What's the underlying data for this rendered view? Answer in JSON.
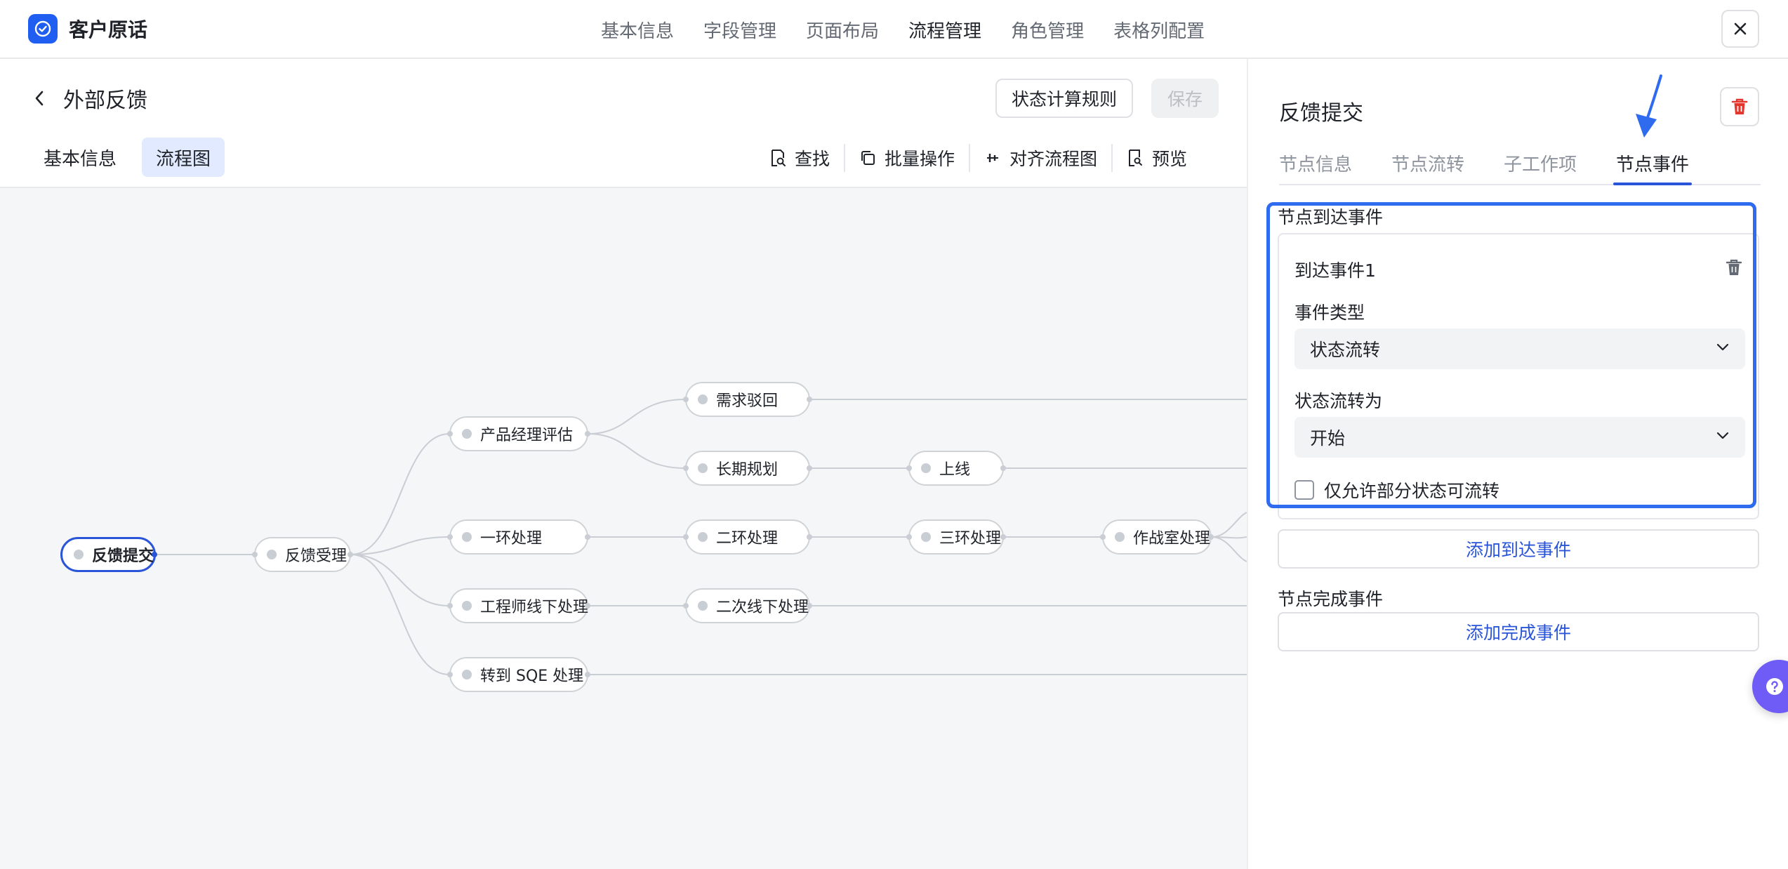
{
  "app": {
    "title": "客户原话",
    "logo_icon": "check-circle-icon",
    "brand_color": "#1f5ef0"
  },
  "topnav": {
    "items": [
      {
        "label": "基本信息"
      },
      {
        "label": "字段管理"
      },
      {
        "label": "页面布局"
      },
      {
        "label": "流程管理"
      },
      {
        "label": "角色管理"
      },
      {
        "label": "表格列配置"
      }
    ],
    "active": "流程管理"
  },
  "header": {
    "title": "外部反馈",
    "rule_button": "状态计算规则",
    "save_button": "保存"
  },
  "subtabs": [
    {
      "label": "基本信息"
    },
    {
      "label": "流程图"
    }
  ],
  "subtab_active": "流程图",
  "toolbar": {
    "find": "查找",
    "batch": "批量操作",
    "align": "对齐流程图",
    "preview": "预览"
  },
  "flow": {
    "nodes": [
      {
        "id": "n0",
        "label": "反馈提交",
        "selected": true
      },
      {
        "id": "n1",
        "label": "反馈受理"
      },
      {
        "id": "n2",
        "label": "产品经理评估"
      },
      {
        "id": "n3",
        "label": "一环处理"
      },
      {
        "id": "n4",
        "label": "工程师线下处理"
      },
      {
        "id": "n5",
        "label": "转到 SQE 处理"
      },
      {
        "id": "n6",
        "label": "需求驳回"
      },
      {
        "id": "n7",
        "label": "长期规划"
      },
      {
        "id": "n8",
        "label": "二环处理"
      },
      {
        "id": "n9",
        "label": "二次线下处理"
      },
      {
        "id": "n10",
        "label": "上线"
      },
      {
        "id": "n11",
        "label": "三环处理"
      },
      {
        "id": "n12",
        "label": "作战室处理"
      }
    ],
    "edges": [
      [
        "n0",
        "n1"
      ],
      [
        "n1",
        "n2"
      ],
      [
        "n1",
        "n3"
      ],
      [
        "n1",
        "n4"
      ],
      [
        "n1",
        "n5"
      ],
      [
        "n2",
        "n6"
      ],
      [
        "n2",
        "n7"
      ],
      [
        "n7",
        "n10"
      ],
      [
        "n3",
        "n8"
      ],
      [
        "n8",
        "n11"
      ],
      [
        "n11",
        "n12"
      ],
      [
        "n4",
        "n9"
      ]
    ]
  },
  "panel": {
    "title": "反馈提交",
    "tabs": [
      {
        "label": "节点信息"
      },
      {
        "label": "节点流转"
      },
      {
        "label": "子工作项"
      },
      {
        "label": "节点事件"
      }
    ],
    "active_tab": "节点事件",
    "arrive_section_label": "节点到达事件",
    "event": {
      "name": "到达事件1",
      "type_label": "事件类型",
      "type_value": "状态流转",
      "target_label": "状态流转为",
      "target_value": "开始",
      "partial_checkbox_label": "仅允许部分状态可流转",
      "partial_checked": false
    },
    "add_arrive_button": "添加到达事件",
    "complete_section_label": "节点完成事件",
    "add_complete_button": "添加完成事件"
  },
  "colors": {
    "accent": "#2a55d9",
    "highlight": "#2f6bef",
    "danger": "#e5362e",
    "help": "#6f5bf5"
  }
}
